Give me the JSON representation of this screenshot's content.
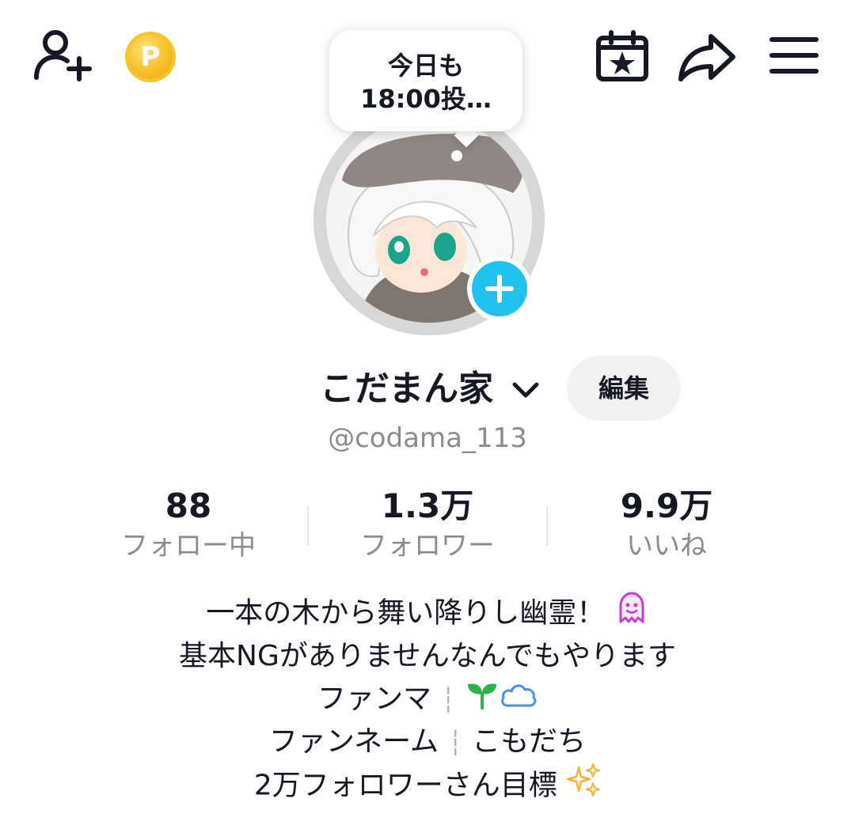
{
  "header": {
    "icons": [
      "add-friend-icon",
      "coin-icon",
      "calendar-star-icon",
      "share-icon",
      "menu-icon"
    ],
    "coin_label": "P"
  },
  "bubble": {
    "text": "今日も\n18:00投…"
  },
  "profile": {
    "name": "こだまん家",
    "edit_label": "編集",
    "handle": "@codama_113"
  },
  "stats": [
    {
      "value": "88",
      "label": "フォロー中"
    },
    {
      "value": "1.3万",
      "label": "フォロワー"
    },
    {
      "value": "9.9万",
      "label": "いいね"
    }
  ],
  "bio": {
    "line1": "一本の木から舞い降りし幽霊！",
    "line2": "基本NGがありませんなんでもやります",
    "line3_a": "ファンマ",
    "line4_a": "ファンネーム",
    "line4_b": "こもだち",
    "line5": "2万フォロワーさん目標",
    "separator": "┆"
  },
  "colors": {
    "accent": "#20c2ed",
    "coin": "#f7b819",
    "ghost": "#c43bd8",
    "sprout": "#2bb34a",
    "cloud": "#4a90e2",
    "sparkle": "#f0b43a"
  }
}
